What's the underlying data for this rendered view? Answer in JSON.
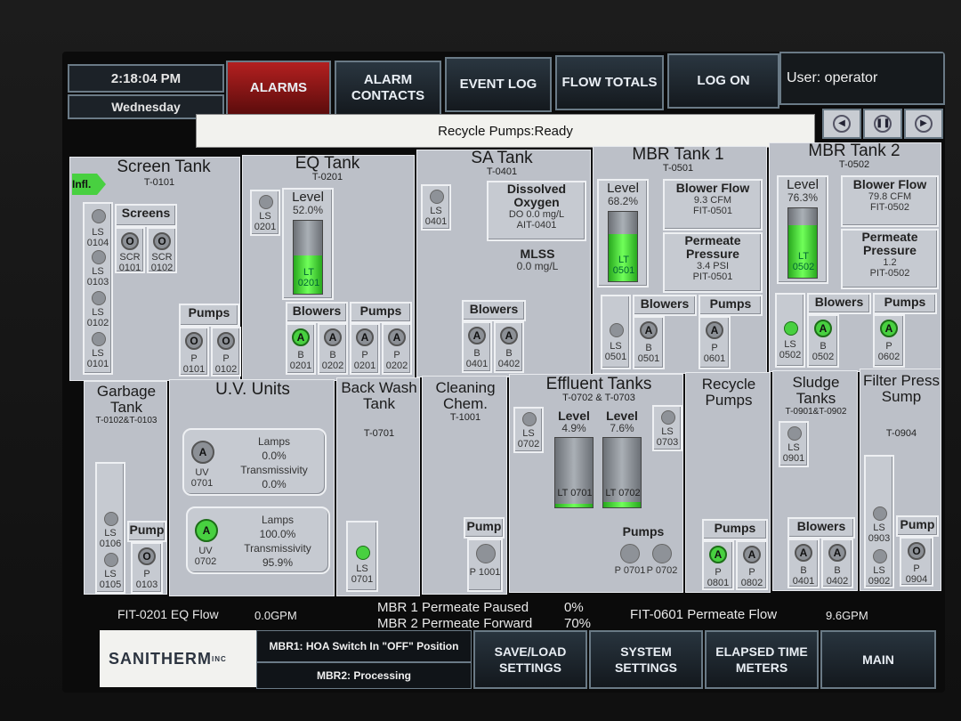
{
  "header": {
    "time": "2:18:04 PM",
    "day": "Wednesday",
    "buttons": {
      "alarms": "ALARMS",
      "alarm_contacts": "ALARM CONTACTS",
      "event_log": "EVENT LOG",
      "flow_totals": "FLOW TOTALS",
      "log_on": "LOG ON"
    },
    "user": "User: operator",
    "status_text": "Recycle Pumps:Ready"
  },
  "screen_tank": {
    "title": "Screen Tank",
    "tag": "T-0101",
    "infl": "Infl.",
    "screens_label": "Screens",
    "pumps_label": "Pumps",
    "ls": [
      "LS 0104",
      "LS 0103",
      "LS 0102",
      "LS 0101"
    ],
    "scr": [
      {
        "state": "O",
        "label": "SCR 0101"
      },
      {
        "state": "O",
        "label": "SCR 0102"
      }
    ],
    "pumps": [
      {
        "state": "O",
        "label": "P 0101"
      },
      {
        "state": "O",
        "label": "P 0102"
      }
    ]
  },
  "eq_tank": {
    "title": "EQ Tank",
    "tag": "T-0201",
    "ls": "LS 0201",
    "level_label": "Level",
    "level_value": "52.0%",
    "level_fraction": 0.52,
    "lt": "LT 0201",
    "blowers_label": "Blowers",
    "pumps_label": "Pumps",
    "blowers": [
      {
        "state": "A",
        "on": true,
        "label": "B 0201"
      },
      {
        "state": "A",
        "on": false,
        "label": "B 0202"
      }
    ],
    "pumps": [
      {
        "state": "A",
        "on": false,
        "label": "P 0201"
      },
      {
        "state": "A",
        "on": false,
        "label": "P 0202"
      }
    ]
  },
  "sa_tank": {
    "title": "SA Tank",
    "tag": "T-0401",
    "ls": "LS 0401",
    "do_title": "Dissolved Oxygen",
    "do_value": "DO 0.0 mg/L",
    "do_tag": "AIT-0401",
    "mlss_label": "MLSS",
    "mlss_value": "0.0 mg/L",
    "blowers_label": "Blowers",
    "blowers": [
      {
        "state": "A",
        "label": "B 0401"
      },
      {
        "state": "A",
        "label": "B 0402"
      }
    ]
  },
  "mbr1": {
    "title": "MBR Tank 1",
    "tag": "T-0501",
    "level_label": "Level",
    "level_value": "68.2%",
    "level_fraction": 0.682,
    "lt": "LT 0501",
    "blower_flow_label": "Blower Flow",
    "blower_flow_value": "9.3 CFM",
    "blower_flow_tag": "FIT-0501",
    "perm_label": "Permeate Pressure",
    "perm_value": "3.4 PSI",
    "perm_tag": "PIT-0501",
    "ls": "LS 0501",
    "blowers_label": "Blowers",
    "pumps_label": "Pumps",
    "blower": {
      "state": "A",
      "label": "B 0501"
    },
    "pump": {
      "state": "A",
      "label": "P 0601"
    }
  },
  "mbr2": {
    "title": "MBR Tank 2",
    "tag": "T-0502",
    "level_label": "Level",
    "level_value": "76.3%",
    "level_fraction": 0.763,
    "lt": "LT 0502",
    "blower_flow_label": "Blower Flow",
    "blower_flow_value": "79.8 CFM",
    "blower_flow_tag": "FIT-0502",
    "perm_label": "Permeate Pressure",
    "perm_value": "1.2",
    "perm_tag": "PIT-0502",
    "ls": "LS 0502",
    "blowers_label": "Blowers",
    "pumps_label": "Pumps",
    "blower": {
      "state": "A",
      "label": "B 0502"
    },
    "pump": {
      "state": "A",
      "label": "P 0602"
    }
  },
  "garbage_tank": {
    "title": "Garbage Tank",
    "tag": "T-0102&T-0103",
    "pump_label": "Pump",
    "ls": [
      "LS 0106",
      "LS 0105"
    ],
    "pump": {
      "state": "O",
      "label": "P 0103"
    }
  },
  "uv": {
    "title": "U.V. Units",
    "units": [
      {
        "state": "A",
        "on": false,
        "label": "UV 0701",
        "lamps_label": "Lamps",
        "lamps": "0.0%",
        "trans_label": "Transmissivity",
        "trans": "0.0%"
      },
      {
        "state": "A",
        "on": true,
        "label": "UV 0702",
        "lamps_label": "Lamps",
        "lamps": "100.0%",
        "trans_label": "Transmissivity",
        "trans": "95.9%"
      }
    ]
  },
  "backwash": {
    "title": "Back Wash Tank",
    "tag": "T-0701",
    "ls": "LS 0701"
  },
  "cleaning": {
    "title": "Cleaning Chem.",
    "tag": "T-1001",
    "pump_label": "Pump",
    "pump": "P 1001"
  },
  "effluent": {
    "title": "Effluent Tanks",
    "tag": "T-0702 & T-0703",
    "ls": [
      "LS 0702",
      "LS 0703"
    ],
    "levels": [
      {
        "label": "Level",
        "value": "4.9%",
        "fraction": 0.049,
        "lt": "LT 0701"
      },
      {
        "label": "Level",
        "value": "7.6%",
        "fraction": 0.076,
        "lt": "LT 0702"
      }
    ],
    "pumps_label": "Pumps",
    "pumps": [
      "P 0701",
      "P 0702"
    ]
  },
  "recycle": {
    "title": "Recycle Pumps",
    "pumps_label": "Pumps",
    "pumps": [
      {
        "state": "A",
        "on": true,
        "label": "P 0801"
      },
      {
        "state": "A",
        "on": false,
        "label": "P 0802"
      }
    ]
  },
  "sludge": {
    "title": "Sludge Tanks",
    "tag": "T-0901&T-0902",
    "ls": "LS 0901",
    "blowers_label": "Blowers",
    "blowers": [
      {
        "state": "A",
        "label": "B 0401"
      },
      {
        "state": "A",
        "label": "B 0402"
      }
    ]
  },
  "filter_press": {
    "title": "Filter Press Sump",
    "tag": "T-0904",
    "pump_label": "Pump",
    "ls": [
      "LS 0903",
      "LS 0902"
    ],
    "pump": {
      "state": "O",
      "label": "P 0904"
    }
  },
  "footer": {
    "eq_flow_label": "FIT-0201 EQ Flow",
    "eq_flow_value": "0.0GPM",
    "mbr1_status": "MBR 1 Permeate Paused",
    "mbr1_pct": "0%",
    "mbr2_status": "MBR 2 Permeate Forward",
    "mbr2_pct": "70%",
    "perm_flow_label": "FIT-0601 Permeate Flow",
    "perm_flow_value": "9.6GPM"
  },
  "bottom": {
    "logo": "SANITHERM",
    "logo_suffix": "INC",
    "msg1": "MBR1: HOA Switch In \"OFF\" Position",
    "msg2": "MBR2: Processing",
    "save_load": "SAVE/LOAD SETTINGS",
    "system": "SYSTEM SETTINGS",
    "elapsed": "ELAPSED TIME METERS",
    "main": "MAIN"
  }
}
